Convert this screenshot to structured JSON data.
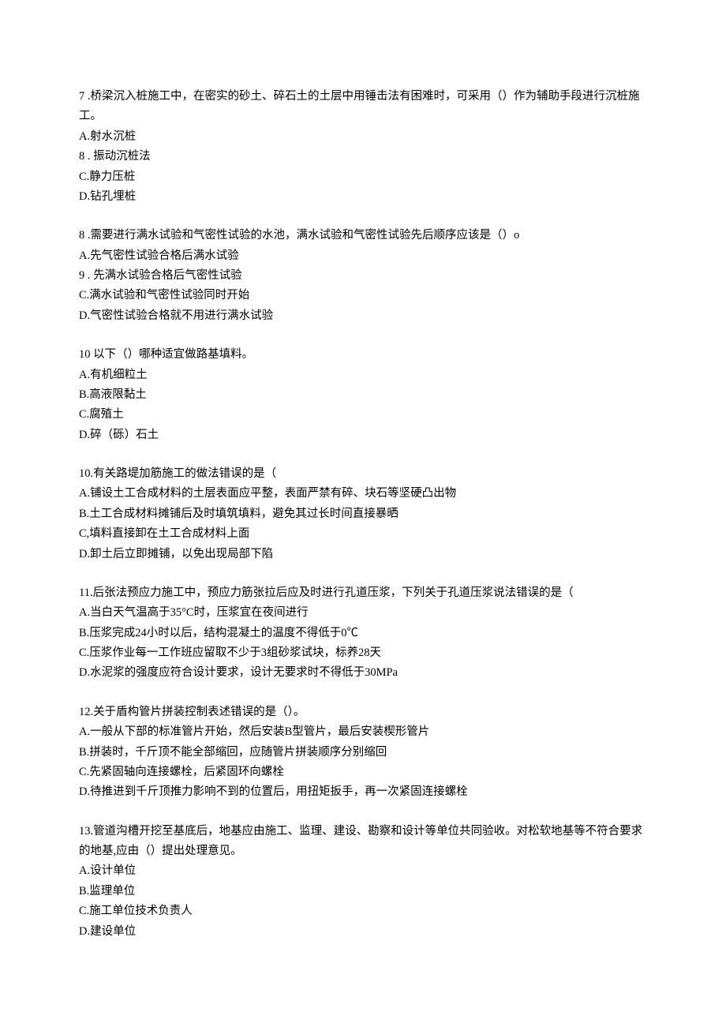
{
  "questions": [
    {
      "stem": "7 .桥梁沉入桩施工中，在密实的砂土、碎石土的土层中用锤击法有困难时，可采用（）作为辅助手段进行沉桩施工。",
      "options": [
        "A.射水沉桩",
        "8 . 振动沉桩法",
        "C.静力压桩",
        "D.钻孔埋桩"
      ]
    },
    {
      "stem": "8 .需要进行满水试验和气密性试验的水池，满水试验和气密性试验先后顺序应该是（）o",
      "options": [
        "A.先气密性试验合格后满水试验",
        "9 . 先满水试验合格后气密性试验",
        "C.满水试验和气密性试验同时开始",
        "D.气密性试验合格就不用进行满水试验"
      ]
    },
    {
      "stem": "10 以下（）哪种适宜做路基填料。",
      "options": [
        "A.有机细粒土",
        "B.高液限黏土",
        "C.腐殖土",
        "D.碎（砾）石土"
      ]
    },
    {
      "stem": "10.有关路堤加筋施工的做法错误的是（",
      "options": [
        "A.铺设土工合成材料的土层表面应平整，表面严禁有碎、块石等坚硬凸出物",
        "B.土工合成材料摊铺后及时填筑填料，避免其过长时间直接暴晒",
        "C,填料直接卸在土工合成材料上面",
        "D.卸土后立即摊铺，以免出现局部下陷"
      ]
    },
    {
      "stem": "11.后张法预应力施工中，预应力筋张拉后应及时进行孔道压浆，下列关于孔道压浆说法错误的是（",
      "options": [
        "A.当白天气温高于35°C时，压浆宜在夜间进行",
        "B.压浆完成24小时以后，结构混凝土的温度不得低于0℃",
        "C.压浆作业每一工作班应留取不少于3组砂浆试块，标养28天",
        "D.水泥浆的强度应符合设计要求，设计无要求时不得低于30MPa"
      ]
    },
    {
      "stem": "12.关于盾构管片拼装控制表述错误的是（）。",
      "options": [
        "A.一般从下部的标准管片开始，然后安装B型管片，最后安装楔形管片",
        "B.拼装时，千斤顶不能全部缩回，应随管片拼装顺序分别缩回",
        "C.先紧固轴向连接螺栓，后紧固环向螺栓",
        "D.待推进到千斤顶推力影响不到的位置后，用扭矩扳手，再一次紧固连接螺栓"
      ]
    },
    {
      "stem": "13.管道沟槽开挖至基底后，地基应由施工、监理、建设、勘察和设计等单位共同验收。对松软地基等不符合要求的地基,应由（）提出处理意见。",
      "options": [
        "A.设计单位",
        "B.监理单位",
        "C.施工单位技术负责人",
        "",
        "D.建设单位"
      ]
    }
  ]
}
